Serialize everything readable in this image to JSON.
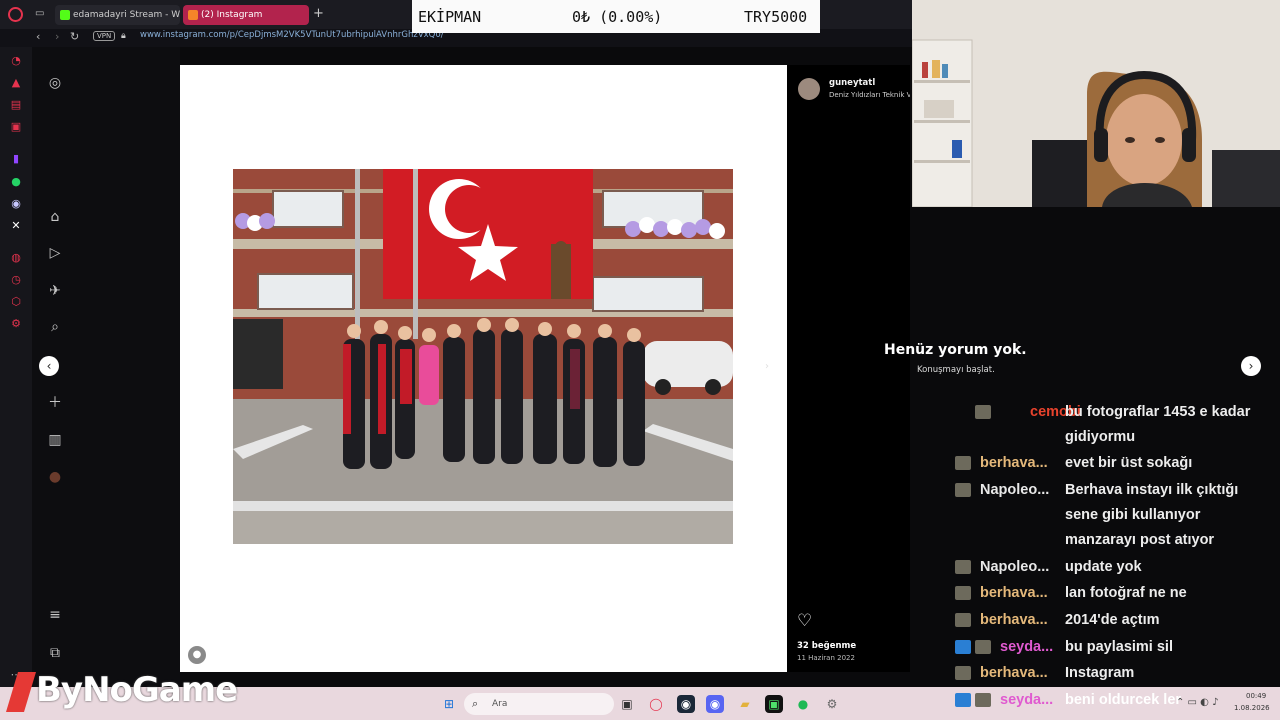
{
  "browser": {
    "tabs": [
      {
        "label": "edamadayri Stream - Watc"
      },
      {
        "label": "(2) Instagram"
      }
    ],
    "new_tab_label": "+",
    "vpn_label": "VPN",
    "url": "www.instagram.com/p/CepDjmsM2VK5VTunUt7ubrhipulAVnhrGhzVxQ0/"
  },
  "ticker": {
    "label": "EKİPMAN",
    "change": "0₺ (0.00%)",
    "value": "TRY5000"
  },
  "post": {
    "username": "guneytatl",
    "location": "Deniz Yıldızları Teknik V",
    "no_comments_title": "Henüz yorum yok.",
    "no_comments_sub": "Konuşmayı başlat.",
    "likes": "32 beğenme",
    "date": "11 Haziran 2022"
  },
  "chat": [
    {
      "user": "cemobi",
      "color": "#e8432d",
      "msg": "bu fotograflar 1453 e kadar gidiyormu"
    },
    {
      "user": "berhava...",
      "color": "#e4b87a",
      "msg": "evet bir üst sokağı"
    },
    {
      "user": "Napoleo...",
      "color": "#e8e8e8",
      "msg": "Berhava instayı ilk çıktığı sene gibi kullanıyor manzarayı post atıyor"
    },
    {
      "user": "Napoleo...",
      "color": "#e8e8e8",
      "msg": "update yok"
    },
    {
      "user": "berhava...",
      "color": "#e4b87a",
      "msg": "lan fotoğraf ne ne"
    },
    {
      "user": "berhava...",
      "color": "#e4b87a",
      "msg": "2014'de açtım"
    },
    {
      "user": "seyda...",
      "color": "#e05ad0",
      "msg": "bu paylasimi sil"
    },
    {
      "user": "berhava...",
      "color": "#e4b87a",
      "msg": "Instagram"
    },
    {
      "user": "seyda...",
      "color": "#e05ad0",
      "msg": "beni oldurcek ler"
    }
  ],
  "taskbar": {
    "search_placeholder": "Ara",
    "time": "00:49",
    "date": "1.08.2026"
  },
  "watermark": "ByNoGame",
  "colors": {
    "accent": "#b2234d",
    "flag_red": "#d21c24"
  }
}
